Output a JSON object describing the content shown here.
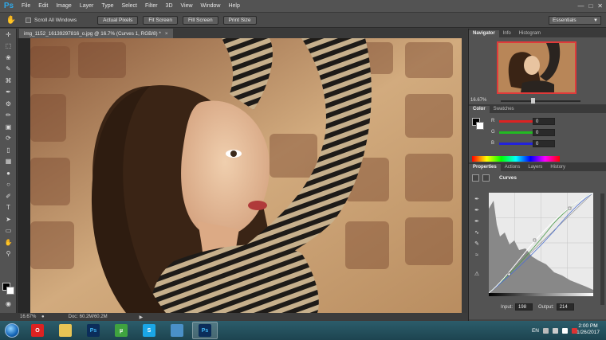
{
  "app": {
    "logo": "Ps"
  },
  "menu": [
    "File",
    "Edit",
    "Image",
    "Layer",
    "Type",
    "Select",
    "Filter",
    "3D",
    "View",
    "Window",
    "Help"
  ],
  "options_bar": {
    "scroll_all_windows": "Scroll All Windows",
    "buttons": [
      "Actual Pixels",
      "Fit Screen",
      "Fill Screen",
      "Print Size"
    ],
    "workspace": "Essentials"
  },
  "document": {
    "tab_title": "img_1152_16139297816_o.jpg @ 16.7% (Curves 1, RGB/8) *",
    "zoom": "16.67%",
    "doc_size": "Doc: 60.2M/60.2M"
  },
  "navigator": {
    "tabs": [
      "Navigator",
      "Info",
      "Histogram"
    ],
    "zoom": "16.67%",
    "zoom_slider": 0.4
  },
  "color": {
    "tabs": [
      "Color",
      "Swatches"
    ],
    "channels": [
      {
        "label": "R",
        "value": "0",
        "color": "#d22"
      },
      {
        "label": "G",
        "value": "0",
        "color": "#2b2"
      },
      {
        "label": "B",
        "value": "0",
        "color": "#22d"
      }
    ]
  },
  "properties": {
    "tabs": [
      "Properties",
      "Actions",
      "Layers",
      "History"
    ],
    "title": "Curves",
    "input_label": "Input:",
    "input_value": "198",
    "output_label": "Output:",
    "output_value": "214"
  },
  "taskbar": {
    "language": "EN",
    "time": "2:00 PM",
    "date": "1/26/2017",
    "apps": [
      {
        "name": "opera",
        "label": "O",
        "color": "#d22"
      },
      {
        "name": "explorer",
        "label": "",
        "color": "#e8c455"
      },
      {
        "name": "photoshop-a",
        "label": "Ps",
        "color": "#0b2d5a"
      },
      {
        "name": "utorrent",
        "label": "µ",
        "color": "#3fa33f"
      },
      {
        "name": "skype",
        "label": "S",
        "color": "#1aa6e6"
      },
      {
        "name": "photo-viewer",
        "label": "",
        "color": "#4a90c8"
      },
      {
        "name": "photoshop-b",
        "label": "Ps",
        "color": "#0b2d5a"
      }
    ]
  }
}
